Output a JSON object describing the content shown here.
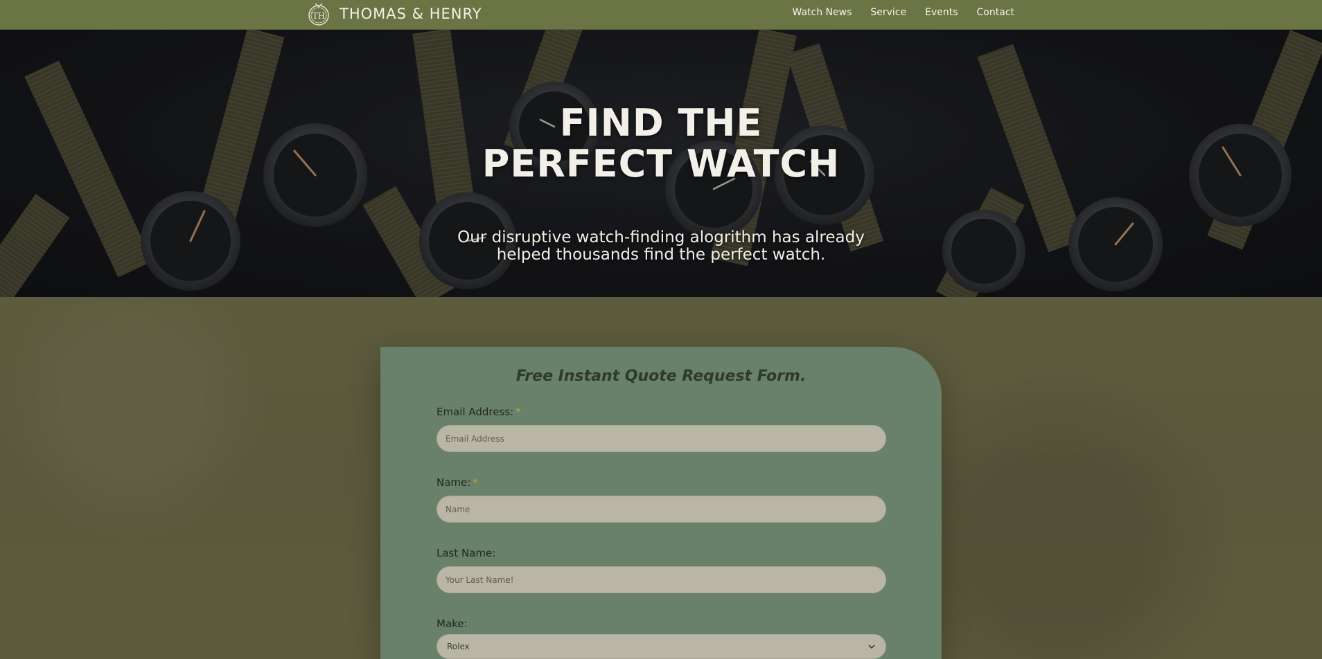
{
  "header": {
    "brand": "THOMAS & HENRY",
    "logo_icon": "th-monogram-crest-icon",
    "nav": [
      "Watch News",
      "Service",
      "Events",
      "Contact"
    ]
  },
  "hero": {
    "title_line1": "FIND THE",
    "title_line2": "PERFECT WATCH",
    "subtitle_line1": "Our disruptive watch-finding alogrithm has already",
    "subtitle_line2": "helped thousands find the perfect watch."
  },
  "form": {
    "title": "Free Instant Quote Request Form.",
    "required_marker": "*",
    "email": {
      "label": "Email Address:",
      "placeholder": "Email Address"
    },
    "name": {
      "label": "Name:",
      "placeholder": "Name"
    },
    "last_name": {
      "label": "Last Name:",
      "placeholder": "Your Last Name!"
    },
    "make": {
      "label": "Make:",
      "selected": "Rolex",
      "icon": "chevron-down-icon"
    }
  },
  "colors": {
    "header_bg": "#6a7445",
    "card_bg": "#69806a",
    "input_bg": "#b9b6a6",
    "required": "#c79f3a",
    "page_bg": "#5e5c3f"
  }
}
